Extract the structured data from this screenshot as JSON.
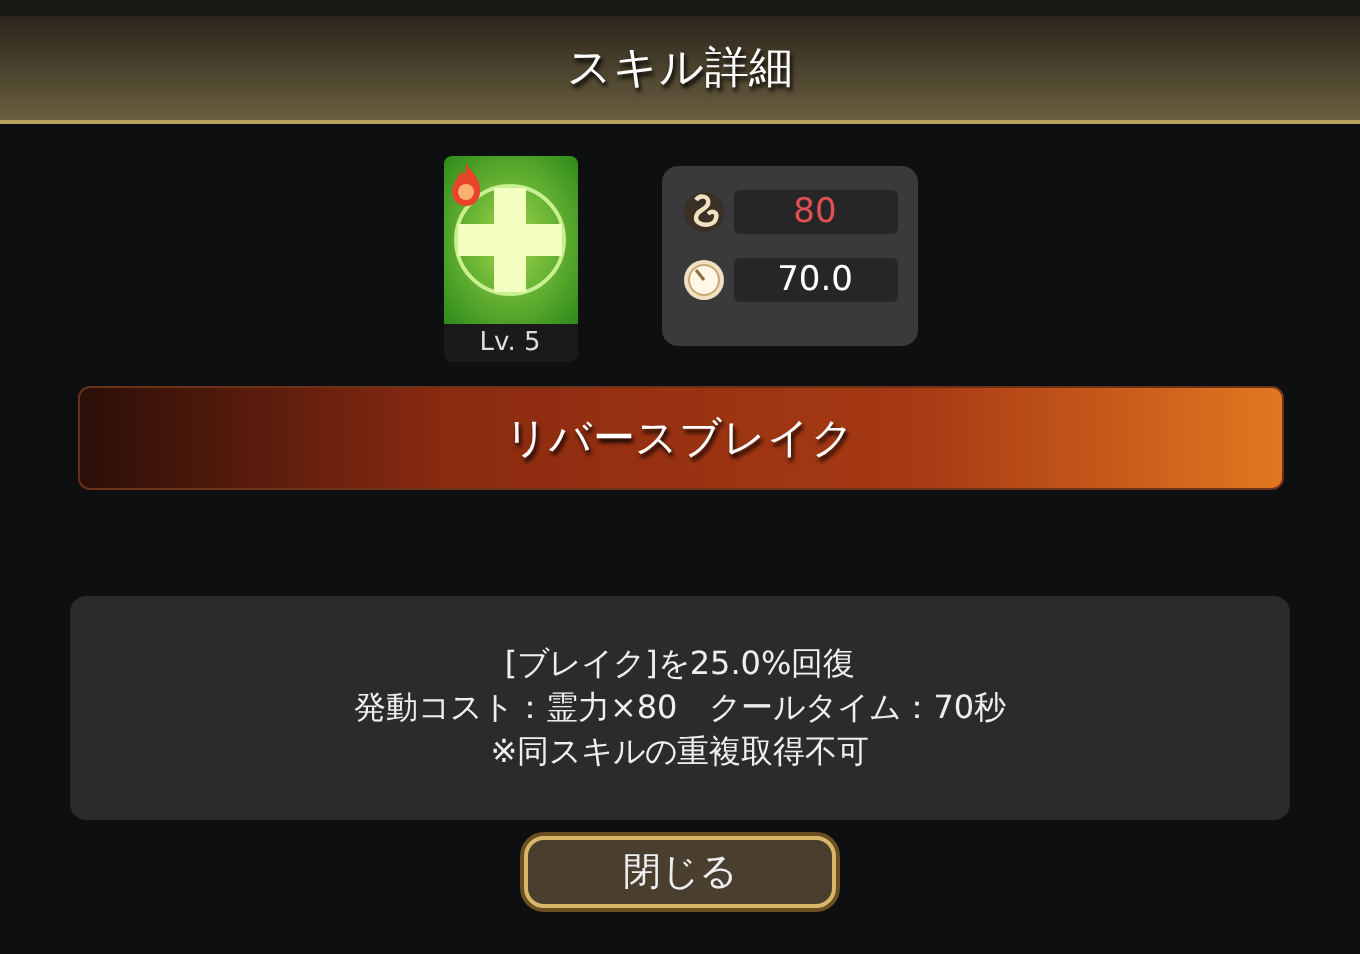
{
  "dialog": {
    "title": "スキル詳細"
  },
  "skill": {
    "badge": {
      "kind": "fire"
    },
    "level": "Lv. 5",
    "name": "リバースブレイク",
    "stats": [
      {
        "kind": "cost",
        "value": "80"
      },
      {
        "kind": "cooldown",
        "value": "70.0"
      }
    ],
    "description": [
      "[ブレイク]を25.0%回復",
      "発動コスト：霊力×80　クールタイム：70秒",
      "※同スキルの重複取得不可"
    ]
  },
  "buttons": [
    {
      "label": "閉じる"
    }
  ]
}
